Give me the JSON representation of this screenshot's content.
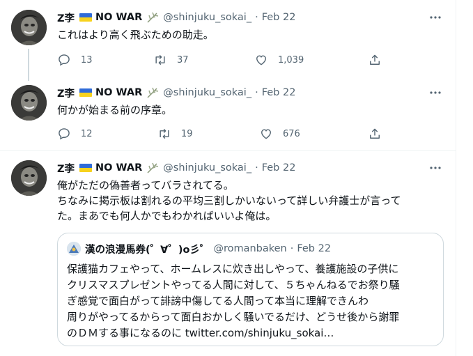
{
  "tweets": [
    {
      "author_name": "Z李",
      "author_suffix": "NO WAR",
      "handle": "@shinjuku_sokai_",
      "separator": "·",
      "date": "Feb 22",
      "text": "これはより高く飛ぶための助走。",
      "replies": "13",
      "retweets": "37",
      "likes": "1,039"
    },
    {
      "author_name": "Z李",
      "author_suffix": "NO WAR",
      "handle": "@shinjuku_sokai_",
      "separator": "·",
      "date": "Feb 22",
      "text": "何かが始まる前の序章。",
      "replies": "12",
      "retweets": "19",
      "likes": "676"
    },
    {
      "author_name": "Z李",
      "author_suffix": "NO WAR",
      "handle": "@shinjuku_sokai_",
      "separator": "·",
      "date": "Feb 22",
      "text_lines": [
        "俺がただの偽善者ってバラされてる。",
        "ちなみに掲示板は割れるの平均三割しかいないって詳しい弁護士が言って",
        "た。まあでも何人かでもわかればいいよ俺は。"
      ],
      "quote": {
        "author_name": "漢の浪漫馬券(゜∀゜)o彡゜",
        "handle": "@romanbaken",
        "separator": "·",
        "date": "Feb 22",
        "text_lines": [
          "保護猫カフェやって、ホームレスに炊き出しやって、養護施設の子供に",
          "クリスマスプレゼントやってる人間に対して、５ちゃんねるでお祭り騒",
          "ぎ感覚で面白がって誹謗中傷してる人間って本当に理解できんわ",
          "周りがやってるからって面白おかしく騒いでるだけ、どうせ後から謝罪",
          "のＤＭする事になるのに twitter.com/shinjuku_sokai…"
        ]
      }
    }
  ],
  "icons": {
    "reply": "reply-icon",
    "retweet": "retweet-icon",
    "like": "heart-icon",
    "share": "share-icon",
    "more": "more-icon"
  },
  "colors": {
    "text": "#0f1419",
    "secondary": "#536471",
    "border": "#cfd9de",
    "flag_blue": "#2f6bd8",
    "flag_yellow": "#f7d21e"
  }
}
